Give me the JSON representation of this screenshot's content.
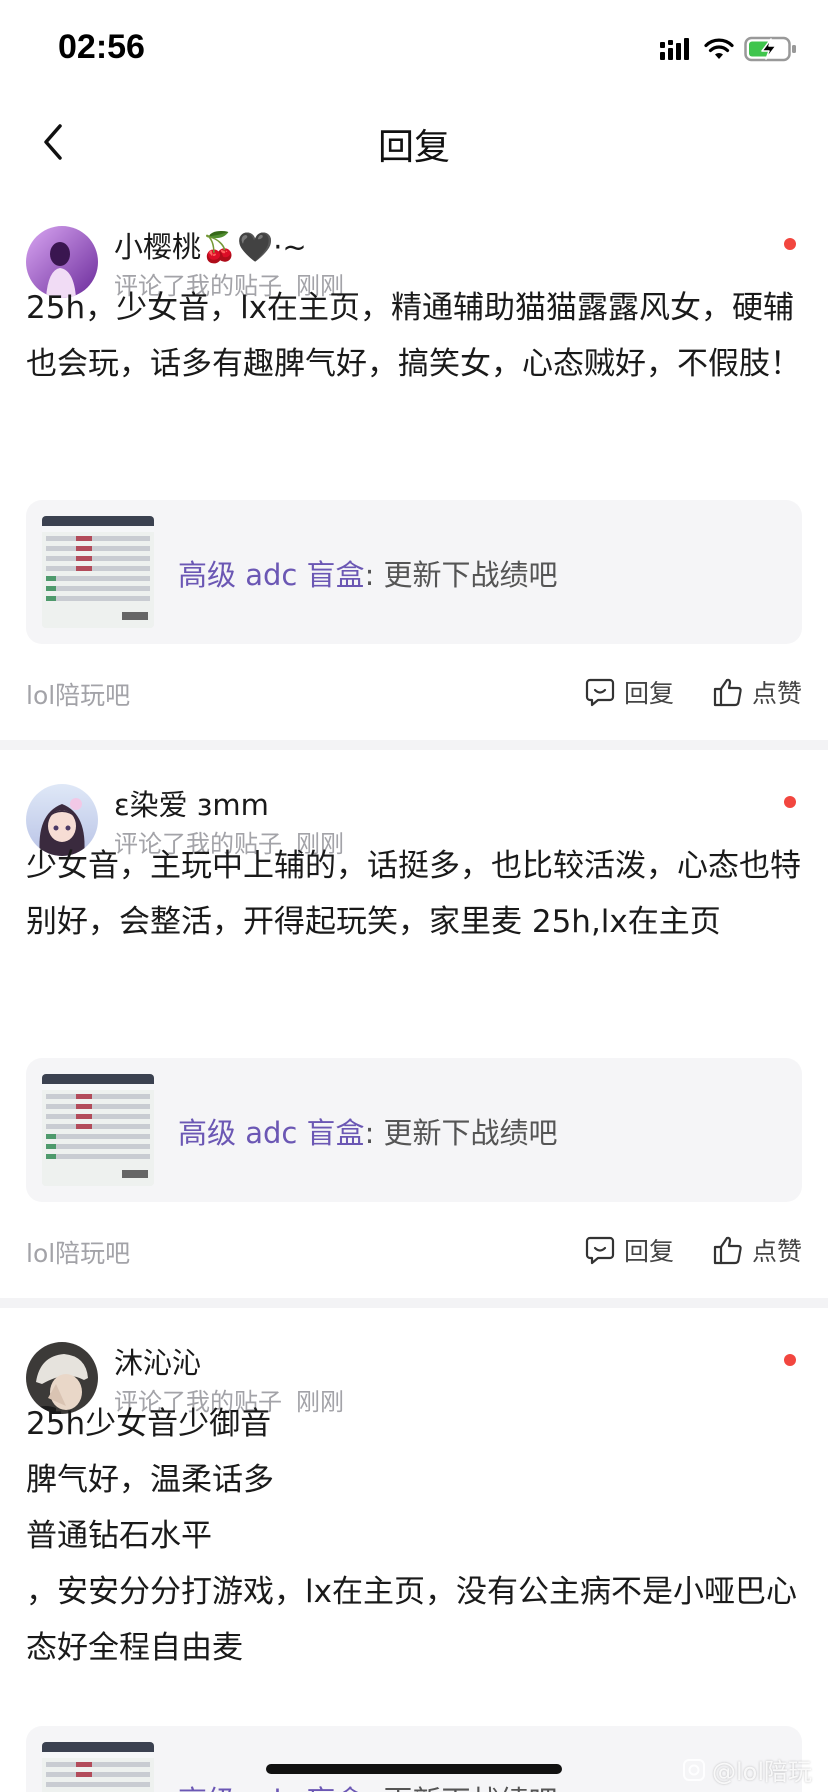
{
  "status_bar": {
    "time": "02:56"
  },
  "header": {
    "title": "回复"
  },
  "posts": [
    {
      "user_name": "小樱桃🍒🖤·~",
      "meta_action": "评论了我的贴子",
      "meta_time": "刚刚",
      "content": "25h，少女音，lx在主页，精通辅助猫猫露露风女，硬辅也会玩，话多有趣脾气好，搞笑女，心态贼好，不假肢！",
      "quote_link": "高级 adc 盲盒",
      "quote_rest": ": 更新下战绩吧",
      "forum": "lol陪玩吧",
      "reply_label": "回复",
      "like_label": "点赞"
    },
    {
      "user_name": "ε染爱 ɜmm",
      "meta_action": "评论了我的贴子",
      "meta_time": "刚刚",
      "content": "少女音，主玩中上辅的，话挺多，也比较活泼，心态也特别好，会整活，开得起玩笑，家里麦 25h,lx在主页",
      "quote_link": "高级 adc 盲盒",
      "quote_rest": ": 更新下战绩吧",
      "forum": "lol陪玩吧",
      "reply_label": "回复",
      "like_label": "点赞"
    },
    {
      "user_name": "沐沁沁",
      "meta_action": "评论了我的贴子",
      "meta_time": "刚刚",
      "content": "25h少女音少御音\n脾气好，温柔话多\n普通钻石水平\n，安安分分打游戏，lx在主页，没有公主病不是小哑巴心态好全程自由麦",
      "quote_link": "高级 adc 盲盒",
      "quote_rest": ": 更新下战绩吧"
    }
  ],
  "watermark": "@lol陪玩",
  "colors": {
    "accent_link": "#6b57b4",
    "unread_dot": "#f2463f",
    "muted_text": "#a3a3a8",
    "card_bg": "#f5f5f7"
  }
}
